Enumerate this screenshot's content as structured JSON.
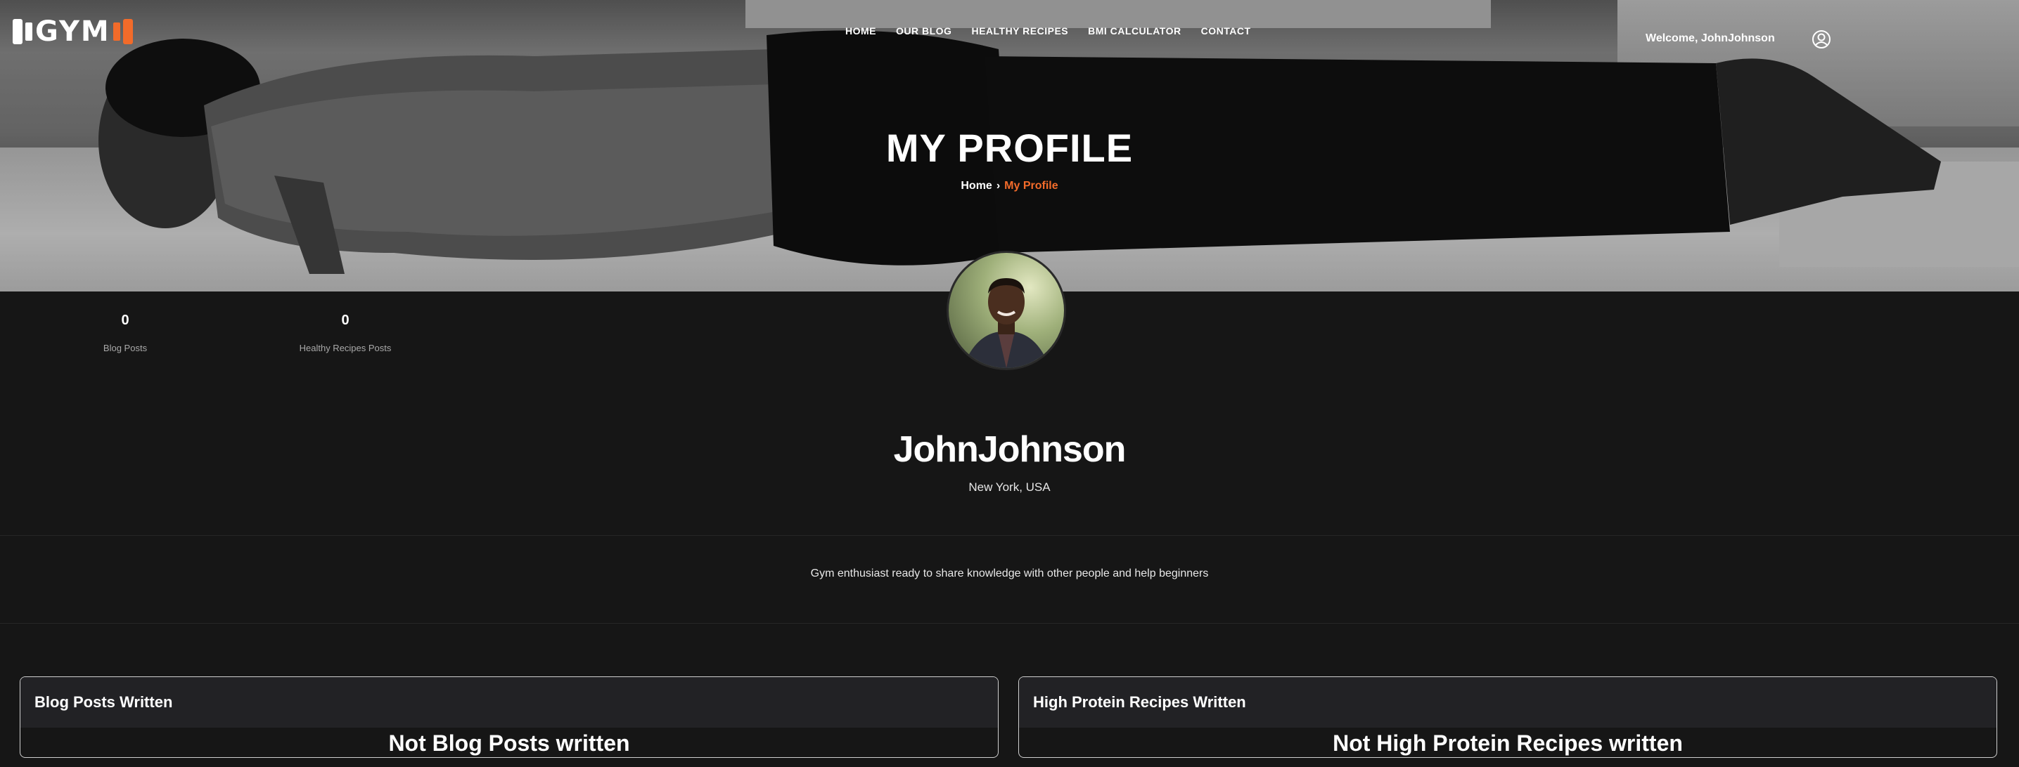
{
  "brand": {
    "logo_text": "GYM",
    "accent": "#f26b2a"
  },
  "nav": {
    "items": [
      {
        "label": "HOME"
      },
      {
        "label": "OUR BLOG"
      },
      {
        "label": "HEALTHY RECIPES"
      },
      {
        "label": "BMI CALCULATOR"
      },
      {
        "label": "CONTACT"
      }
    ],
    "welcome": "Welcome, JohnJohnson",
    "user_icon": "user-circle-icon"
  },
  "hero": {
    "title": "MY PROFILE",
    "breadcrumb": {
      "home": "Home",
      "separator": "›",
      "current": "My Profile"
    }
  },
  "stats": [
    {
      "value": "0",
      "label": "Blog Posts"
    },
    {
      "value": "0",
      "label": "Healthy Recipes Posts"
    }
  ],
  "profile": {
    "name": "JohnJohnson",
    "location": "New York, USA",
    "bio": "Gym enthusiast ready to share knowledge with other people and help beginners"
  },
  "cards": [
    {
      "title": "Blog Posts Written",
      "empty_text": "Not Blog Posts written"
    },
    {
      "title": "High Protein Recipes Written",
      "empty_text": "Not High Protein Recipes written"
    }
  ]
}
